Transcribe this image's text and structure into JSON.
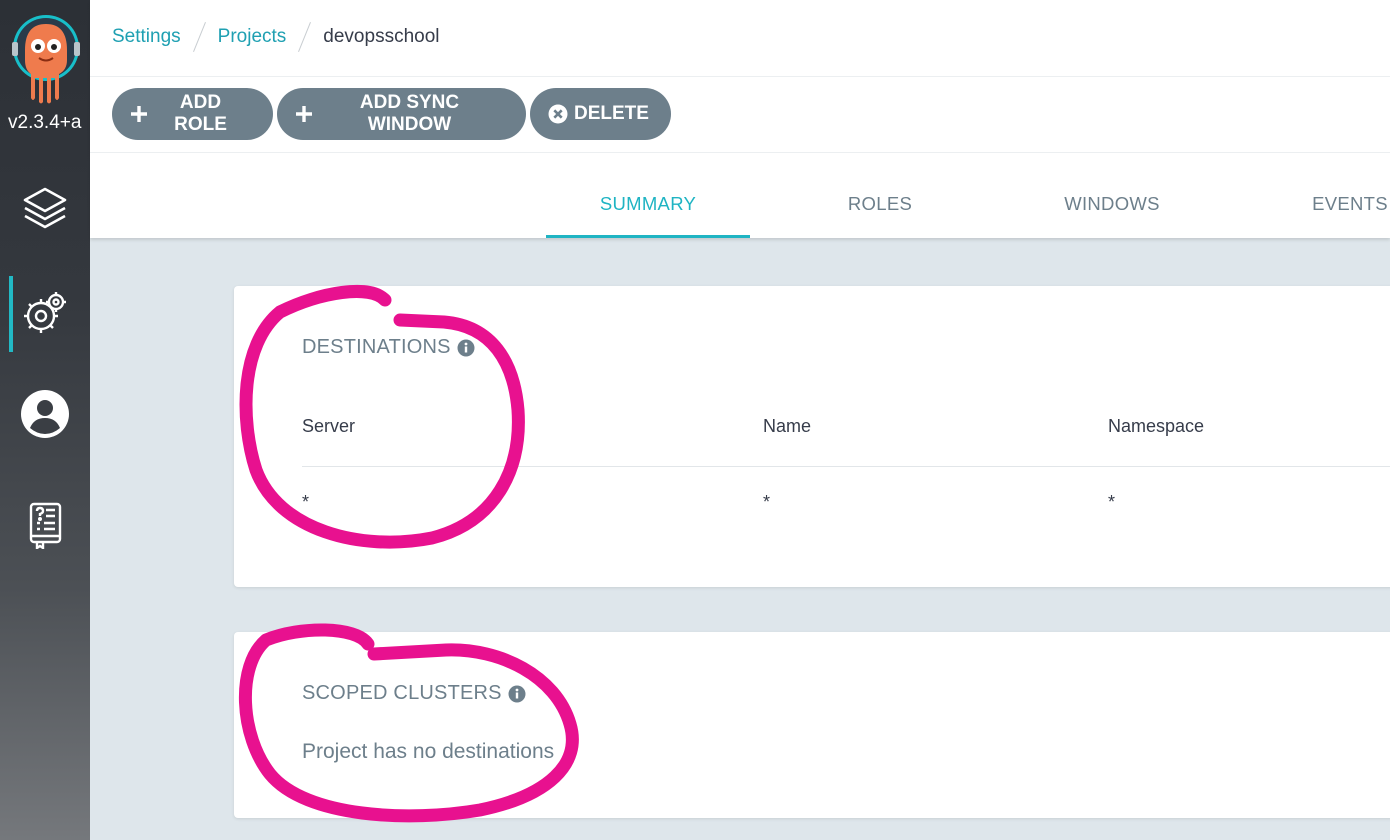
{
  "app": {
    "version": "v2.3.4+a",
    "logo": "argo-octopus-logo"
  },
  "sidebar": {
    "items": [
      {
        "name": "applications",
        "icon": "layers-icon",
        "active": false
      },
      {
        "name": "settings",
        "icon": "gears-icon",
        "active": true
      },
      {
        "name": "user-info",
        "icon": "user-circle-icon",
        "active": false
      },
      {
        "name": "documentation",
        "icon": "book-icon",
        "active": false
      }
    ]
  },
  "breadcrumb": {
    "items": [
      "Settings",
      "Projects"
    ],
    "current": "devopsschool"
  },
  "toolbar": {
    "add_role": "ADD ROLE",
    "add_sync_window": "ADD SYNC WINDOW",
    "delete": "DELETE"
  },
  "tabs": [
    "SUMMARY",
    "ROLES",
    "WINDOWS",
    "EVENTS"
  ],
  "active_tab": "SUMMARY",
  "destinations": {
    "title": "DESTINATIONS",
    "columns": [
      "Server",
      "Name",
      "Namespace"
    ],
    "rows": [
      [
        "*",
        "*",
        "*"
      ]
    ]
  },
  "scoped_clusters": {
    "title": "SCOPED CLUSTERS",
    "empty_message": "Project has no destinations"
  },
  "colors": {
    "accent": "#1fb4c3",
    "link": "#1fa0b2",
    "button": "#6d7f8b",
    "annotation": "#e8118f",
    "background": "#dee6eb"
  }
}
